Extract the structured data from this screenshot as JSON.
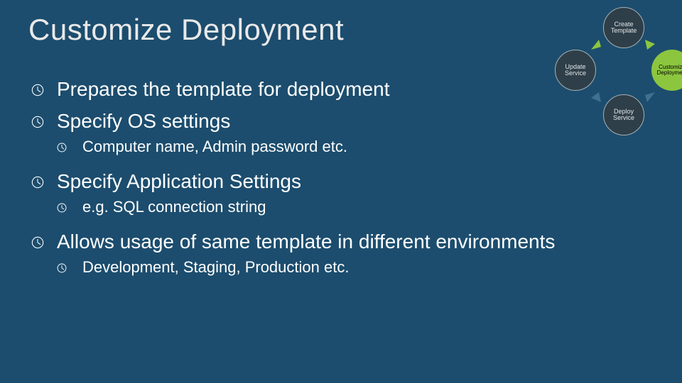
{
  "title": "Customize Deployment",
  "bullets": [
    {
      "text": "Prepares the template for deployment",
      "sub": []
    },
    {
      "text": "Specify OS settings",
      "sub": [
        "Computer name, Admin password etc."
      ]
    },
    {
      "text": "Specify Application Settings",
      "sub": [
        "e.g. SQL connection string"
      ]
    },
    {
      "text": "Allows usage of same template in different environments",
      "sub": [
        "Development, Staging, Production etc."
      ]
    }
  ],
  "diagram": {
    "top": "Create\nTemplate",
    "right": "Customize\nDeployment",
    "bottom": "Deploy\nService",
    "left": "Update\nService"
  },
  "colors": {
    "bg": "#1c4d6e",
    "accent_green": "#8cc63f",
    "node_dark": "#2f3f49"
  }
}
